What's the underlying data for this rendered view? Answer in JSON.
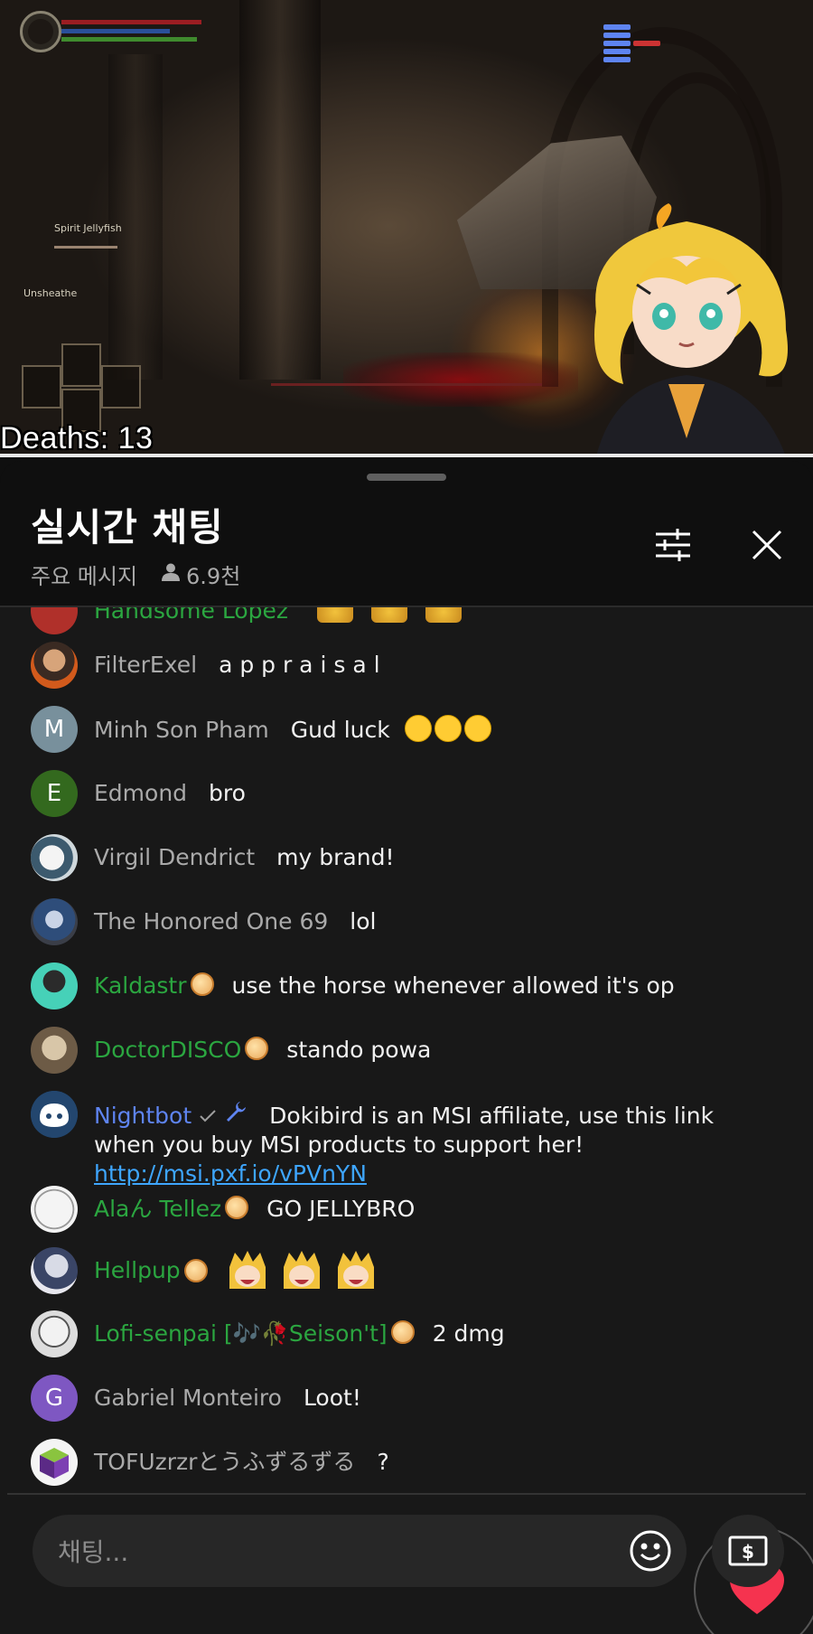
{
  "stream": {
    "deaths_counter": "Deaths: 13",
    "hud": {
      "item_label": "Spirit Jellyfish",
      "action_label": "Unsheathe"
    }
  },
  "chat": {
    "title": "실시간 채팅",
    "mode": "주요 메시지",
    "viewers": "6.9천",
    "partial_author": "Handsome Lopez",
    "messages": [
      {
        "author": "FilterExel",
        "text": "a p p r a i s a l",
        "role": "viewer"
      },
      {
        "author": "Minh Son Pham",
        "text": "Gud luck",
        "avatar_letter": "M",
        "role": "viewer"
      },
      {
        "author": "Edmond",
        "text": "bro",
        "avatar_letter": "E",
        "role": "viewer"
      },
      {
        "author": "Virgil Dendrict",
        "text": "my brand!",
        "role": "viewer"
      },
      {
        "author": "The Honored One 69",
        "text": "lol",
        "role": "viewer"
      },
      {
        "author": "Kaldastr",
        "text": "use the horse whenever allowed it's op",
        "role": "member"
      },
      {
        "author": "DoctorDISCO",
        "text": "stando powa",
        "role": "member"
      },
      {
        "author": "Nightbot",
        "text": "Dokibird is an MSI affiliate, use this link when you buy MSI products to support her!",
        "link": "http://msi.pxf.io/vPVnYN",
        "role": "moderator"
      },
      {
        "author": "Alaん Tellez",
        "text": "GO JELLYBRO",
        "role": "member"
      },
      {
        "author": "Hellpup",
        "text": "",
        "role": "member"
      },
      {
        "author": "Lofi-senpai [🎶🥀Seison't]",
        "text": "2 dmg",
        "role": "member"
      },
      {
        "author": "Gabriel Monteiro",
        "text": "Loot!",
        "avatar_letter": "G",
        "role": "viewer"
      },
      {
        "author": "TOFUzrzrとうふずるずる",
        "text": "?",
        "role": "viewer"
      }
    ],
    "input_placeholder": "채팅...",
    "colors": {
      "member": "#2ba640",
      "moderator": "#5e84f1",
      "viewer": "#aaaaaa",
      "link": "#3ea6ff",
      "heart": "#f5334f"
    },
    "icons": [
      "filter-icon",
      "close-icon",
      "person-icon",
      "heart-icon",
      "emoji-icon",
      "super-chat-icon",
      "wrench-icon",
      "verified-check-icon"
    ]
  }
}
